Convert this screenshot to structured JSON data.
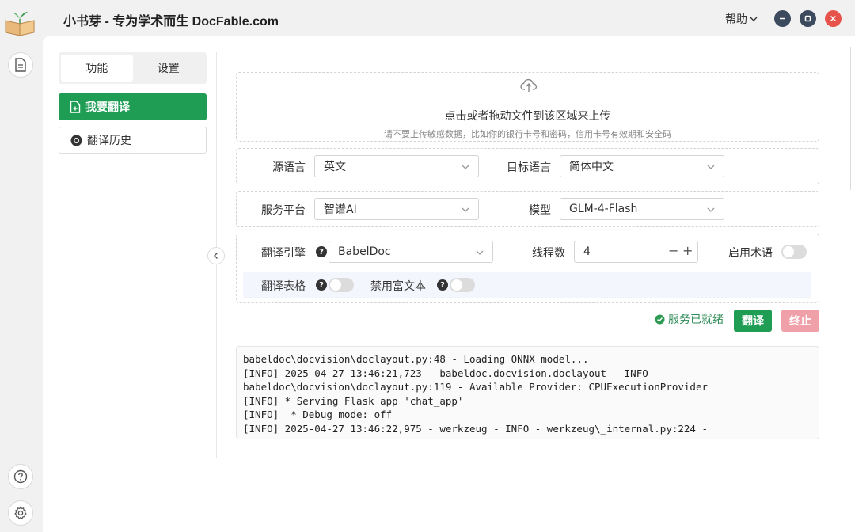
{
  "window": {
    "title": "小书芽 - 专为学术而生 DocFable.com",
    "help": "帮助",
    "colors": {
      "minimize": "#3c4a5e",
      "maximize": "#3c4a5e",
      "close": "#e5534b"
    }
  },
  "rail": {
    "top_icon": "document-icon",
    "bottom_icons": [
      "help-circle-icon",
      "gear-icon"
    ]
  },
  "sidebar": {
    "tabs": [
      {
        "label": "功能",
        "active": true
      },
      {
        "label": "设置",
        "active": false
      }
    ],
    "items": [
      {
        "label": "我要翻译",
        "active": true
      },
      {
        "label": "翻译历史",
        "active": false
      }
    ],
    "accent": "#1f9d55"
  },
  "upload": {
    "title": "点击或者拖动文件到该区域来上传",
    "hint": "请不要上传敏感数据，比如你的银行卡号和密码，信用卡号有效期和安全码"
  },
  "language": {
    "source_label": "源语言",
    "source_value": "英文",
    "target_label": "目标语言",
    "target_value": "简体中文"
  },
  "service": {
    "platform_label": "服务平台",
    "platform_value": "智谱AI",
    "model_label": "模型",
    "model_value": "GLM-4-Flash"
  },
  "engine": {
    "engine_label": "翻译引擎",
    "engine_value": "BabelDoc",
    "threads_label": "线程数",
    "threads_value": "4",
    "terms_label": "启用术语",
    "terms_on": false,
    "table_label": "翻译表格",
    "table_on": false,
    "richtext_label": "禁用富文本",
    "richtext_on": false
  },
  "actions": {
    "status": "服务已就绪",
    "translate": "翻译",
    "stop": "终止",
    "stop_color": "#f0a0a8"
  },
  "log": {
    "lines": [
      "babeldoc\\docvision\\doclayout.py:48 - Loading ONNX model...",
      "[INFO] 2025-04-27 13:46:21,723 - babeldoc.docvision.doclayout - INFO -",
      "babeldoc\\docvision\\doclayout.py:119 - Available Provider: CPUExecutionProvider",
      "[INFO] * Serving Flask app 'chat_app'",
      "[INFO]  * Debug mode: off",
      "[INFO] 2025-04-27 13:46:22,975 - werkzeug - INFO - werkzeug\\_internal.py:224 -"
    ]
  }
}
